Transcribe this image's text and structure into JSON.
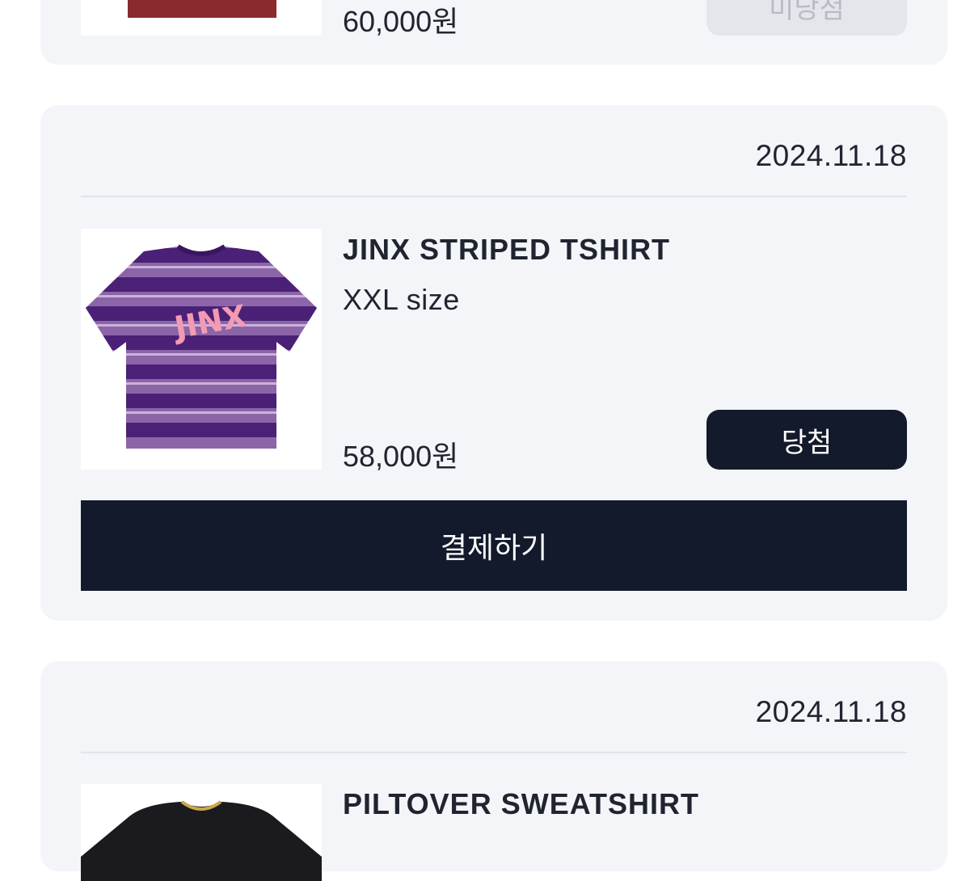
{
  "orders": [
    {
      "price": "60,000원",
      "status_label": "미당첨",
      "product_color": "#8a2a2f"
    },
    {
      "date": "2024.11.18",
      "product_name": "JINX STRIPED TSHIRT",
      "option": "XXL size",
      "price": "58,000원",
      "status_label": "당첨",
      "pay_label": "결제하기",
      "product_image_text": "JINX",
      "colors": {
        "stripe_dark": "#4a2176",
        "stripe_light": "#8c64a8",
        "logo": "#f39bb3"
      }
    },
    {
      "date": "2024.11.18",
      "product_name": "PILTOVER SWEATSHIRT"
    }
  ],
  "colors": {
    "card_bg": "#f3f5f8",
    "primary_button": "#131a2b",
    "disabled_button": "#e4e6eb"
  }
}
